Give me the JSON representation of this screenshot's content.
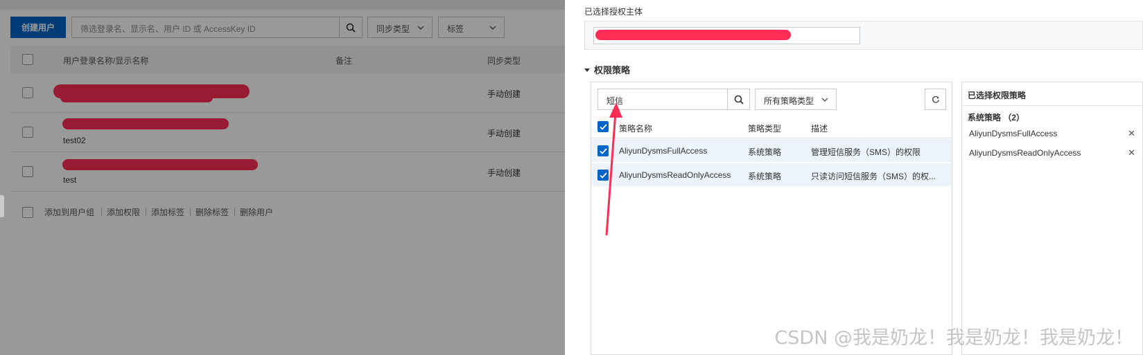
{
  "users_page": {
    "create_button": "创建用户",
    "search_placeholder": "筛选登录名、显示名、用户 ID 或 AccessKey ID",
    "filter_sync_type": "同步类型",
    "filter_tags": "标签",
    "columns": [
      "用户登录名称/显示名称",
      "备注",
      "同步类型"
    ],
    "rows": [
      {
        "sub": "",
        "sync": "手动创建"
      },
      {
        "sub": "test02",
        "sync": "手动创建"
      },
      {
        "sub": "test",
        "sync": "手动创建"
      }
    ],
    "bulk_actions": [
      "添加到用户组",
      "添加权限",
      "添加标签",
      "删除标签",
      "删除用户"
    ]
  },
  "drawer": {
    "selected_principal_label": "已选择授权主体",
    "policy_section_title": "权限策略",
    "keyword_value": "短信",
    "policy_type_select": "所有策略类型",
    "table_columns": [
      "策略名称",
      "策略类型",
      "描述"
    ],
    "policies": [
      {
        "name": "AliyunDysmsFullAccess",
        "type": "系统策略",
        "desc": "管理短信服务（SMS）的权限"
      },
      {
        "name": "AliyunDysmsReadOnlyAccess",
        "type": "系统策略",
        "desc": "只读访问短信服务（SMS）的权..."
      }
    ],
    "selected_panel_title": "已选择权限策略",
    "selected_group": "系统策略 （2）",
    "selected_items": [
      "AliyunDysmsFullAccess",
      "AliyunDysmsReadOnlyAccess"
    ]
  },
  "watermark": "CSDN @我是奶龙！我是奶龙！我是奶龙！",
  "colors": {
    "primary": "#0064c8",
    "redaction": "#ff2d55",
    "selected_row": "#edf3fb"
  }
}
